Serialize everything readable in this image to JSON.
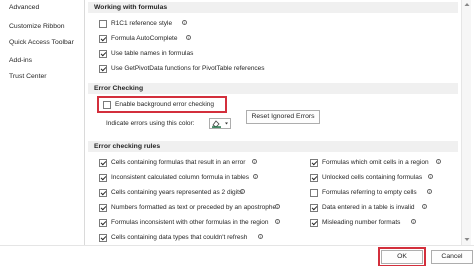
{
  "nav": {
    "items": [
      "Advanced",
      "Customize Ribbon",
      "Quick Access Toolbar",
      "Add-ins",
      "Trust Center"
    ]
  },
  "working": {
    "title": "Working with formulas",
    "items": [
      {
        "label": "R1C1 reference style",
        "checked": false
      },
      {
        "label": "Formula AutoComplete",
        "checked": true
      },
      {
        "label": "Use table names in formulas",
        "checked": true
      },
      {
        "label": "Use GetPivotData functions for PivotTable references",
        "checked": true
      }
    ]
  },
  "error_checking": {
    "title": "Error Checking",
    "enable_label": "Enable background error checking",
    "enable_checked": false,
    "indicate_label": "Indicate errors using this color:",
    "reset_label": "Reset Ignored Errors"
  },
  "rules": {
    "title": "Error checking rules",
    "left": [
      {
        "label": "Cells containing formulas that result in an error",
        "checked": true
      },
      {
        "label": "Inconsistent calculated column formula in tables",
        "checked": true
      },
      {
        "label": "Cells containing years represented as 2 digits",
        "checked": true
      },
      {
        "label": "Numbers formatted as text or preceded by an apostrophe",
        "checked": true
      },
      {
        "label": "Formulas inconsistent with other formulas in the region",
        "checked": true
      },
      {
        "label": "Cells containing data types that couldn't refresh",
        "checked": true
      }
    ],
    "right": [
      {
        "label": "Formulas which omit cells in a region",
        "checked": true
      },
      {
        "label": "Unlocked cells containing formulas",
        "checked": true
      },
      {
        "label": "Formulas referring to empty cells",
        "checked": false
      },
      {
        "label": "Data entered in a table is invalid",
        "checked": true
      },
      {
        "label": "Misleading number formats",
        "checked": true
      }
    ]
  },
  "footer": {
    "ok_label": "OK",
    "cancel_label": "Cancel"
  },
  "colors": {
    "highlight": "#d32f3c",
    "header_bg": "#f0f0f0",
    "accent_green": "#1e7145"
  }
}
